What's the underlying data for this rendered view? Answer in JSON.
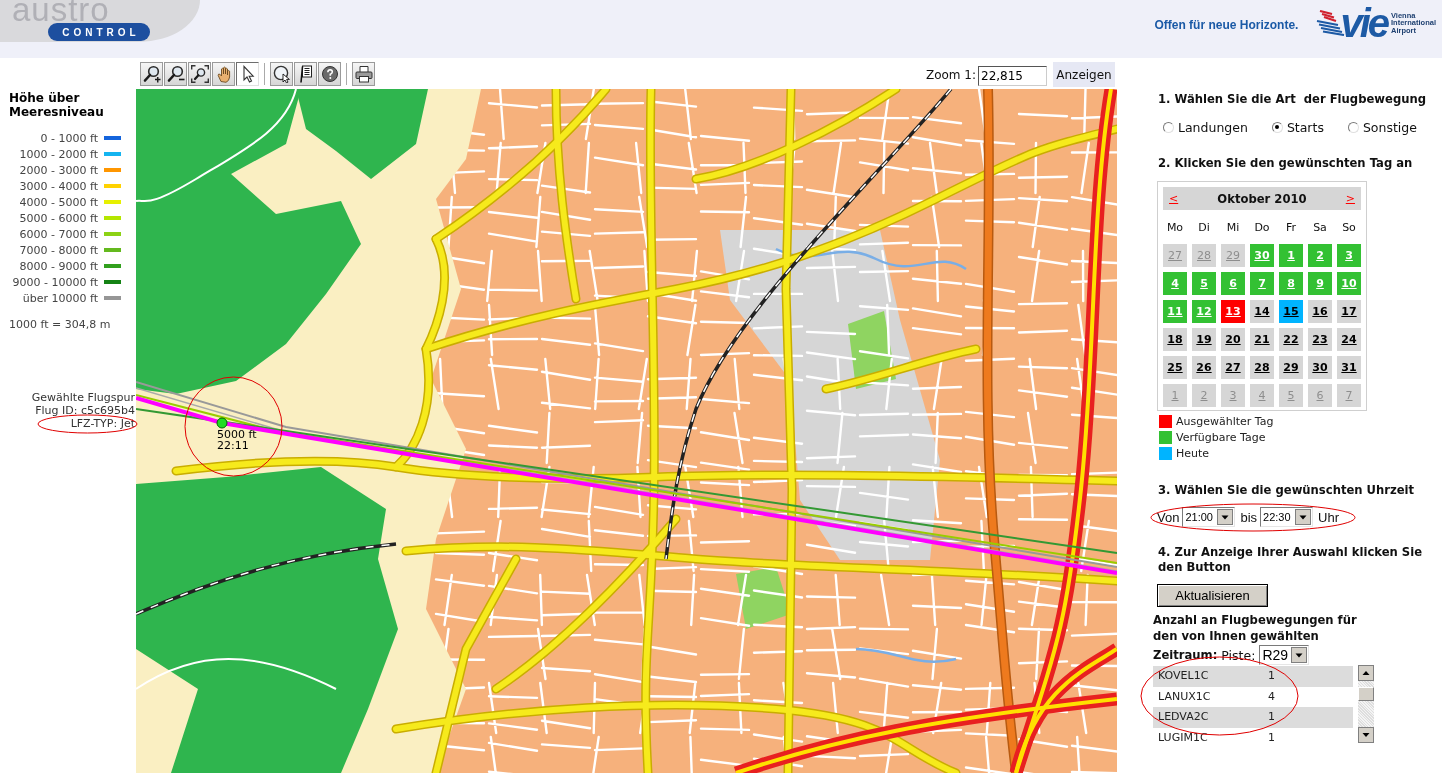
{
  "header": {
    "logo": {
      "word": "austro",
      "badge": "CONTROL"
    },
    "slogan": "Offen für neue Horizonte.",
    "airport_logo": {
      "wordmark": "vie",
      "caption": "Vienna International Airport"
    }
  },
  "toolbar": {
    "groups": [
      [
        {
          "selected": false
        },
        {
          "selected": false
        },
        {
          "selected": false
        },
        {
          "selected": false
        },
        {
          "selected": true
        }
      ],
      [
        {
          "selected": false
        },
        {
          "selected": false
        },
        {
          "selected": false
        }
      ],
      [
        {
          "selected": false
        }
      ]
    ]
  },
  "zoom": {
    "label": "Zoom 1:",
    "value": "22,815",
    "button": "Anzeigen"
  },
  "legend": {
    "title": "Höhe über Meeresniveau",
    "items": [
      {
        "label": "0 - 1000 ft",
        "color": "#1464dc"
      },
      {
        "label": "1000 - 2000 ft",
        "color": "#14b4f0"
      },
      {
        "label": "2000 - 3000 ft",
        "color": "#ff9600"
      },
      {
        "label": "3000 - 4000 ft",
        "color": "#ffd200"
      },
      {
        "label": "4000 - 5000 ft",
        "color": "#e6f000"
      },
      {
        "label": "5000 - 6000 ft",
        "color": "#b4e600"
      },
      {
        "label": "6000 - 7000 ft",
        "color": "#8cd214"
      },
      {
        "label": "7000 - 8000 ft",
        "color": "#64b91e"
      },
      {
        "label": "8000 - 9000 ft",
        "color": "#32a01e"
      },
      {
        "label": "9000 - 10000 ft",
        "color": "#148214"
      },
      {
        "label": "über 10000 ft",
        "color": "#969696"
      }
    ],
    "note": "1000 ft = 304,8 m"
  },
  "selected_flight": {
    "title": "Gewählte Flugspur",
    "flight_id": "Flug ID: c5c695b4",
    "aircraft_type": "LFZ-TYP: Jet"
  },
  "map": {
    "track_point": {
      "altitude": "5000 ft",
      "time": "22:11"
    }
  },
  "panel": {
    "step1": {
      "heading": "1. Wählen Sie die Art  der Flugbewegung",
      "options": [
        {
          "label": "Landungen",
          "selected": false
        },
        {
          "label": "Starts",
          "selected": true
        },
        {
          "label": "Sonstige",
          "selected": false
        }
      ]
    },
    "step2": {
      "heading": "2. Klicken Sie den gewünschten Tag an",
      "calendar": {
        "prev": "<",
        "title": "Oktober 2010",
        "next": ">",
        "weekdays": [
          "Mo",
          "Di",
          "Mi",
          "Do",
          "Fr",
          "Sa",
          "So"
        ],
        "weeks": [
          [
            {
              "label": "27",
              "kind": "outside",
              "today": false,
              "selected": false
            },
            {
              "label": "28",
              "kind": "outside",
              "today": false,
              "selected": false
            },
            {
              "label": "29",
              "kind": "outside",
              "today": false,
              "selected": false
            },
            {
              "label": "30",
              "kind": "available",
              "today": false,
              "selected": false
            },
            {
              "label": "1",
              "kind": "available",
              "today": false,
              "selected": false
            },
            {
              "label": "2",
              "kind": "available",
              "today": false,
              "selected": false
            },
            {
              "label": "3",
              "kind": "available",
              "today": false,
              "selected": false
            }
          ],
          [
            {
              "label": "4",
              "kind": "available",
              "today": false,
              "selected": false
            },
            {
              "label": "5",
              "kind": "available",
              "today": false,
              "selected": false
            },
            {
              "label": "6",
              "kind": "available",
              "today": false,
              "selected": false
            },
            {
              "label": "7",
              "kind": "available",
              "today": false,
              "selected": false
            },
            {
              "label": "8",
              "kind": "available",
              "today": false,
              "selected": false
            },
            {
              "label": "9",
              "kind": "available",
              "today": false,
              "selected": false
            },
            {
              "label": "10",
              "kind": "available",
              "today": false,
              "selected": false
            }
          ],
          [
            {
              "label": "11",
              "kind": "available",
              "today": false,
              "selected": false
            },
            {
              "label": "12",
              "kind": "available",
              "today": false,
              "selected": false
            },
            {
              "label": "13",
              "kind": "available",
              "today": false,
              "selected": true
            },
            {
              "label": "14",
              "kind": "plain",
              "today": false,
              "selected": false
            },
            {
              "label": "15",
              "kind": "plain",
              "today": true,
              "selected": false
            },
            {
              "label": "16",
              "kind": "plain",
              "today": false,
              "selected": false
            },
            {
              "label": "17",
              "kind": "plain",
              "today": false,
              "selected": false
            }
          ],
          [
            {
              "label": "18",
              "kind": "plain",
              "today": false,
              "selected": false
            },
            {
              "label": "19",
              "kind": "plain",
              "today": false,
              "selected": false
            },
            {
              "label": "20",
              "kind": "plain",
              "today": false,
              "selected": false
            },
            {
              "label": "21",
              "kind": "plain",
              "today": false,
              "selected": false
            },
            {
              "label": "22",
              "kind": "plain",
              "today": false,
              "selected": false
            },
            {
              "label": "23",
              "kind": "plain",
              "today": false,
              "selected": false
            },
            {
              "label": "24",
              "kind": "plain",
              "today": false,
              "selected": false
            }
          ],
          [
            {
              "label": "25",
              "kind": "plain",
              "today": false,
              "selected": false
            },
            {
              "label": "26",
              "kind": "plain",
              "today": false,
              "selected": false
            },
            {
              "label": "27",
              "kind": "plain",
              "today": false,
              "selected": false
            },
            {
              "label": "28",
              "kind": "plain",
              "today": false,
              "selected": false
            },
            {
              "label": "29",
              "kind": "plain",
              "today": false,
              "selected": false
            },
            {
              "label": "30",
              "kind": "plain",
              "today": false,
              "selected": false
            },
            {
              "label": "31",
              "kind": "plain",
              "today": false,
              "selected": false
            }
          ],
          [
            {
              "label": "1",
              "kind": "outside",
              "today": false,
              "selected": false
            },
            {
              "label": "2",
              "kind": "outside",
              "today": false,
              "selected": false
            },
            {
              "label": "3",
              "kind": "outside",
              "today": false,
              "selected": false
            },
            {
              "label": "4",
              "kind": "outside",
              "today": false,
              "selected": false
            },
            {
              "label": "5",
              "kind": "outside",
              "today": false,
              "selected": false
            },
            {
              "label": "6",
              "kind": "outside",
              "today": false,
              "selected": false
            },
            {
              "label": "7",
              "kind": "outside",
              "today": false,
              "selected": false
            }
          ]
        ]
      },
      "legend": [
        {
          "label": "Ausgewählter Tag",
          "color": "#ff0000"
        },
        {
          "label": "Verfügbare Tage",
          "color": "#33c133"
        },
        {
          "label": "Heute",
          "color": "#00b4ff"
        }
      ]
    },
    "step3": {
      "heading": "3. Wählen Sie die gewünschten Uhrzeit",
      "from_label": "Von",
      "from_value": "21:00",
      "to_label": "bis",
      "to_value": "22:30",
      "unit": "Uhr"
    },
    "step4": {
      "heading": "4. Zur Anzeige Ihrer Auswahl klicken Sie den Button",
      "button": "Aktualisieren"
    },
    "results": {
      "heading_parts": [
        "Anzahl an Flugbewegungen für den von Ihnen gewählten",
        "Zeitraum:"
      ],
      "runway_label": "Piste:",
      "runway_value": "R29",
      "rows": [
        {
          "route": "KOVEL1C",
          "count": "1"
        },
        {
          "route": "LANUX1C",
          "count": "4"
        },
        {
          "route": "LEDVA2C",
          "count": "1"
        },
        {
          "route": "LUGIM1C",
          "count": "1"
        }
      ]
    }
  }
}
